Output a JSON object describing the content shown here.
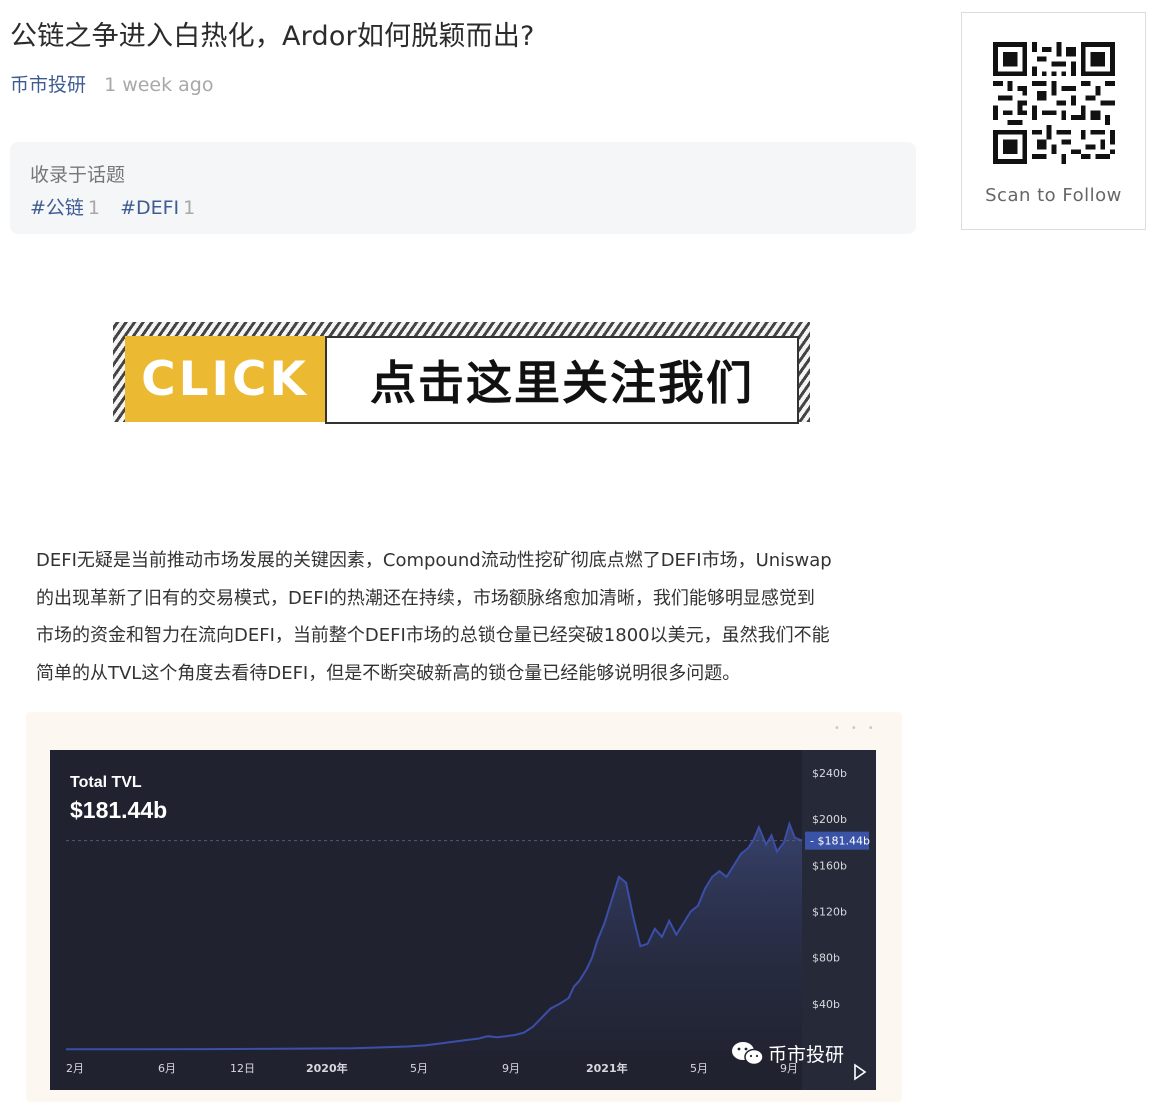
{
  "article": {
    "title": "公链之争进入白热化，Ardor如何脱颖而出?",
    "author": "币市投研",
    "time": "1 week ago",
    "paragraph_lines": [
      "DEFI无疑是当前推动市场发展的关键因素，Compound流动性挖矿彻底点燃了DEFI市场，Uniswap",
      "的出现革新了旧有的交易模式，DEFI的热潮还在持续，市场额脉络愈加清晰，我们能够明显感觉到",
      "市场的资金和智力在流向DEFI，当前整个DEFI市场的总锁仓量已经突破1800以美元，虽然我们不能",
      "简单的从TVL这个角度去看待DEFI，但是不断突破新高的锁仓量已经能够说明很多问题。"
    ]
  },
  "topics": {
    "label": "收录于话题",
    "tags": [
      {
        "name": "#公链",
        "count": "1"
      },
      {
        "name": "#DEFI",
        "count": "1"
      }
    ]
  },
  "qr": {
    "caption": "Scan to Follow",
    "icon": "qr-code-icon"
  },
  "banner": {
    "click_label": "CLICK",
    "text": "点击这里关注我们",
    "accent_color": "#ecb932"
  },
  "embedded_image": {
    "watermark_text": "币市投研",
    "watermark_icon": "wechat-icon",
    "play_icon": "play-icon"
  },
  "chart_data": {
    "type": "area",
    "title": "Total TVL",
    "current_value_label": "$181.44b",
    "current_value": 181.44,
    "x_tick_labels": [
      "2月",
      "6月",
      "12日",
      "2020年",
      "5月",
      "9月",
      "2021年",
      "5月",
      "9月"
    ],
    "y_tick_labels": [
      "$240b",
      "$200b",
      "$160b",
      "$120b",
      "$80b",
      "$40b"
    ],
    "y_ticks": [
      240,
      200,
      160,
      120,
      80,
      40
    ],
    "ylim": [
      0,
      260
    ],
    "x": [
      0,
      4,
      8,
      12,
      16,
      19,
      20,
      21,
      22,
      23,
      23.5,
      24,
      24.5,
      25,
      25.5,
      26,
      26.5,
      27,
      27.5,
      28,
      28.3,
      28.6,
      29,
      29.3,
      29.6,
      30,
      30.4,
      30.8,
      31.2,
      31.6,
      32,
      32.4,
      32.8,
      33.2,
      33.6,
      34,
      34.4,
      34.8,
      35.2,
      35.6,
      36,
      36.4,
      36.8,
      37.2,
      37.6,
      38,
      38.3,
      38.6,
      39,
      39.3,
      39.6,
      40,
      40.3,
      40.6,
      41
    ],
    "values": [
      0.6,
      0.7,
      0.8,
      1.0,
      1.5,
      3,
      4,
      6,
      8,
      10,
      12,
      11,
      12,
      13,
      15,
      20,
      28,
      36,
      40,
      45,
      55,
      60,
      70,
      80,
      95,
      110,
      130,
      150,
      145,
      115,
      90,
      92,
      105,
      98,
      112,
      100,
      110,
      120,
      125,
      140,
      150,
      155,
      150,
      160,
      170,
      175,
      182,
      193,
      178,
      186,
      172,
      180,
      196,
      184,
      181.44
    ],
    "colors": {
      "background": "#20222f",
      "line": "#3b4fa8",
      "fill": "#4a5c9e",
      "highlight": "#3b53a6"
    }
  }
}
